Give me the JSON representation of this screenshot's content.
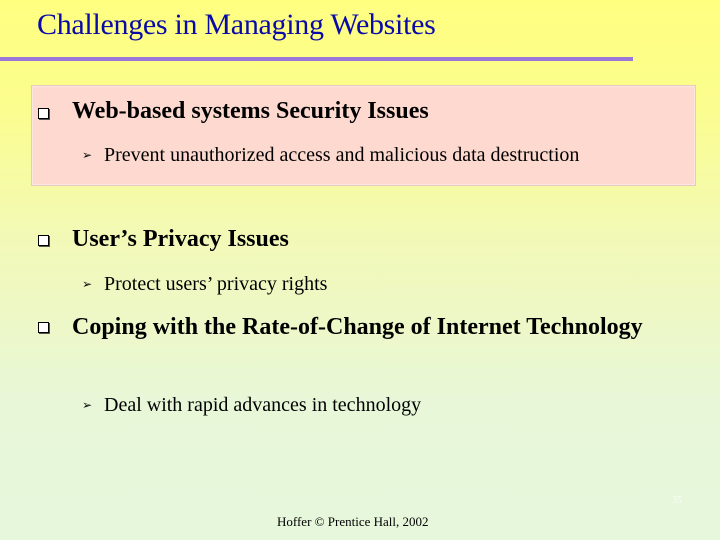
{
  "slide": {
    "title": "Challenges in Managing Websites",
    "bullets": [
      {
        "heading": "Web-based systems Security Issues",
        "sub": "Prevent unauthorized access and malicious data destruction",
        "highlighted": true
      },
      {
        "heading": "User’s Privacy Issues",
        "sub": "Protect users’ privacy rights",
        "highlighted": false
      },
      {
        "heading": "Coping with the Rate-of-Change of Internet Technology",
        "sub": "Deal with rapid advances in technology",
        "highlighted": false
      }
    ],
    "footer": "Hoffer © Prentice Hall, 2002",
    "page_number": "35"
  },
  "icons": {
    "bullet": "square-bullet-icon",
    "sub_bullet": "arrow-bullet-icon"
  },
  "colors": {
    "title": "#0a0aa8",
    "rule": "#9a76d8",
    "highlight_box": "#fdd9cf"
  }
}
